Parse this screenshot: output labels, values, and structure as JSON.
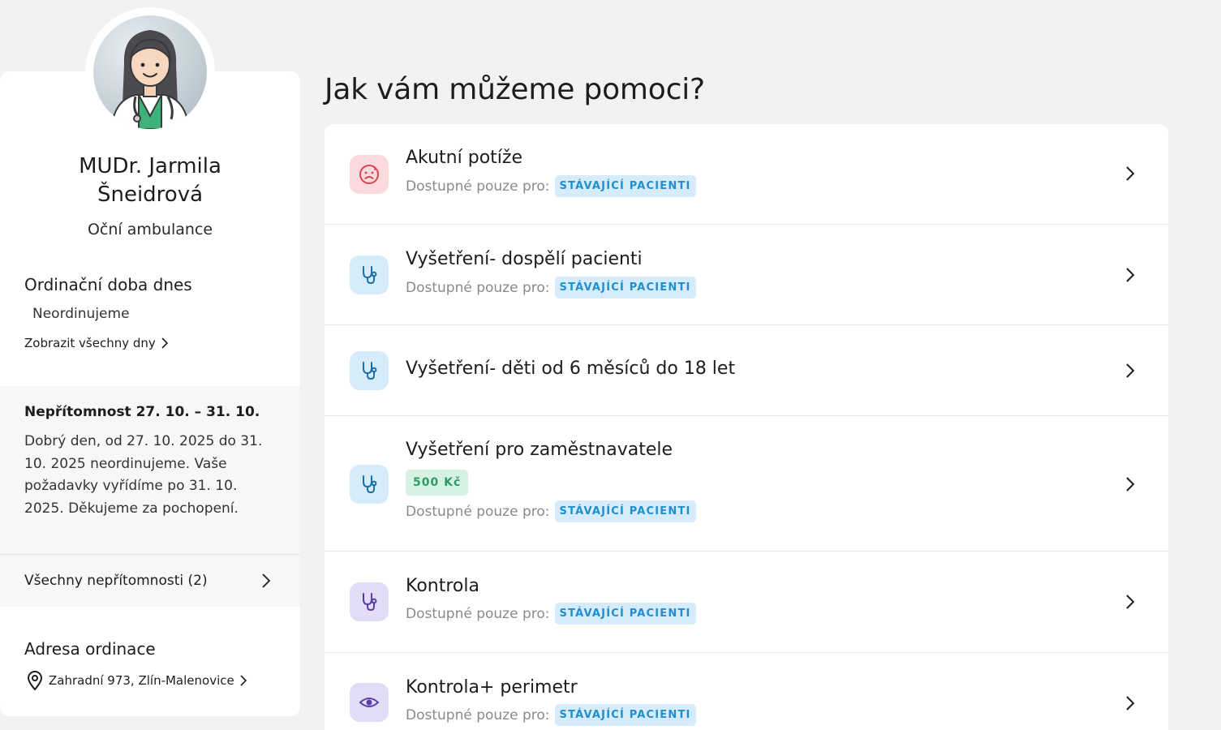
{
  "doctor": {
    "name": "MUDr. Jarmila Šneidrová",
    "specialty": "Oční ambulance",
    "hours_title": "Ordinační doba dnes",
    "hours_today": "Neordinujeme",
    "all_days_link": "Zobrazit všechny dny",
    "absence": {
      "title": "Nepřítomnost 27. 10. – 31. 10.",
      "text": "Dobrý den, od 27. 10. 2025 do 31. 10. 2025 neordinujeme. Vaše požadavky vyřídíme po 31. 10. 2025. Děkujeme za pochopení.",
      "all_link": "Všechny nepřítomnosti (2)"
    },
    "address_title": "Adresa ordinace",
    "address": "Zahradní 973, Zlín-Malenovice"
  },
  "main": {
    "title": "Jak vám můžeme pomoci?",
    "available_label": "Dostupné pouze pro:",
    "patients_badge": "STÁVAJÍCÍ PACIENTI",
    "services": [
      {
        "title": "Akutní potíže",
        "icon": "sad-face-icon",
        "icon_color": "#d9434e"
      },
      {
        "title": "Vyšetření- dospělí pacienti",
        "icon": "stethoscope-icon",
        "icon_color": "#1d6fa8"
      },
      {
        "title": "Vyšetření- děti od 6 měsíců do 18 let",
        "icon": "stethoscope-icon",
        "icon_color": "#1d6fa8"
      },
      {
        "title": "Vyšetření pro zaměstnavatele",
        "price": "500 Kč",
        "icon": "stethoscope-icon",
        "icon_color": "#1d6fa8"
      },
      {
        "title": "Kontrola",
        "icon": "stethoscope-icon",
        "icon_color": "#5a3ea8"
      },
      {
        "title": "Kontrola+ perimetr",
        "icon": "eye-icon",
        "icon_color": "#5a3ea8"
      }
    ]
  },
  "colors": {
    "page_bg": "#f2f2f2",
    "badge_blue_bg": "#d6ecfb",
    "badge_blue_text": "#1f8fcf",
    "price_bg": "#d7f2e4",
    "price_text": "#2d9b63"
  }
}
